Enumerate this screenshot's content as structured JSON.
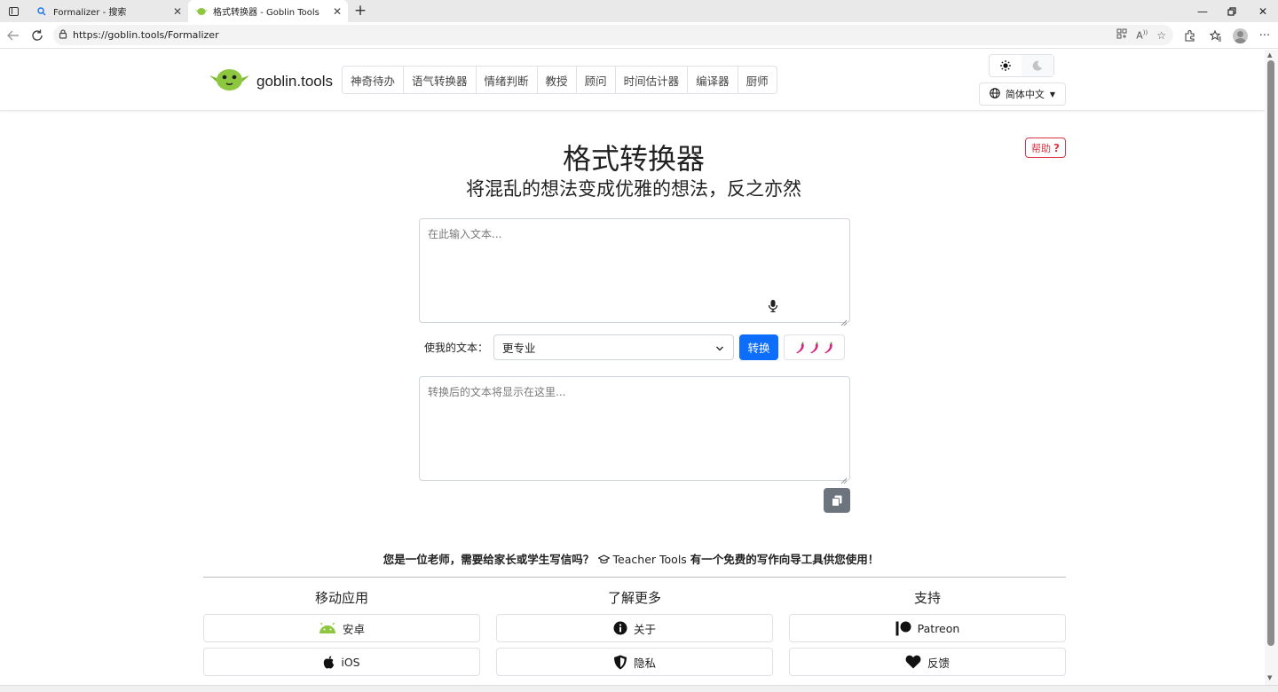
{
  "browser": {
    "tabs": [
      {
        "title": "Formalizer - 搜索",
        "active": false
      },
      {
        "title": "格式转换器 - Goblin Tools",
        "active": true
      }
    ],
    "url": "https://goblin.tools/Formalizer"
  },
  "header": {
    "brand": "goblin.tools",
    "nav": [
      "神奇待办",
      "语气转换器",
      "情绪判断",
      "教授",
      "顾问",
      "时间估计器",
      "编译器",
      "厨师"
    ],
    "language": "简体中文"
  },
  "main": {
    "help_label": "帮助",
    "title": "格式转换器",
    "subtitle": "将混乱的想法变成优雅的想法，反之亦然",
    "input_placeholder": "在此输入文本...",
    "form_label": "使我的文本：",
    "style_selected": "更专业",
    "convert_label": "转换",
    "output_placeholder": "转换后的文本将显示在这里..."
  },
  "teacher": {
    "before": "您是一位老师，需要给家长或学生写信吗？",
    "link": "Teacher Tools",
    "after": " 有一个免费的写作向导工具供您使用！"
  },
  "footer": {
    "col1": {
      "title": "移动应用",
      "android": "安卓",
      "ios": "iOS"
    },
    "col2": {
      "title": "了解更多",
      "about": "关于",
      "privacy": "隐私"
    },
    "col3": {
      "title": "支持",
      "patreon": "Patreon",
      "feedback": "反馈"
    }
  },
  "colors": {
    "primary": "#0d6efd",
    "danger": "#dc3545",
    "secondary": "#6c757d",
    "goblin_green": "#8dc63f"
  }
}
